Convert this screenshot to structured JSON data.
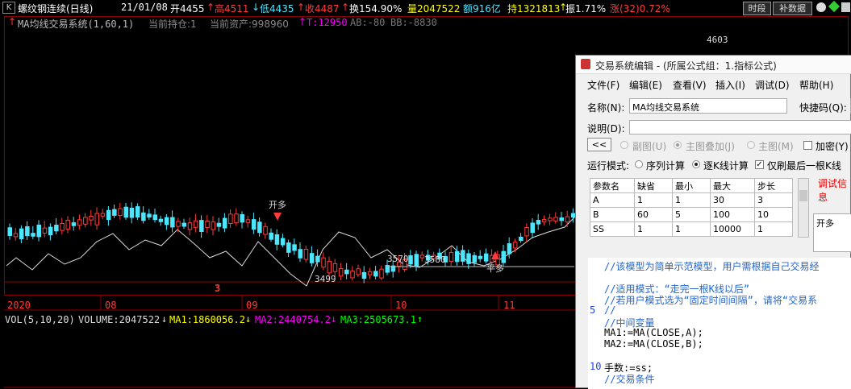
{
  "header": {
    "k_label": "K",
    "title": "螺纹钢连续(日线)",
    "date": "21/01/08",
    "open": "开4455",
    "high": "高4511",
    "low": "低4435",
    "close": "收4487",
    "turnover": "换154.90%",
    "volume": "量2047522",
    "amount": "额916亿",
    "hold": "持1321813",
    "amplitude": "振1.71%",
    "change": "涨(32)0.72%",
    "btn_period": "时段",
    "btn_supplement": "补数据"
  },
  "indicator_line": {
    "name": "MA均线交易系统(1,60,1)",
    "position": "当前持仓:1",
    "assets": "当前资产:998960",
    "t": "T:12950",
    "ab": "AB:-80",
    "bb": "BB:-8830"
  },
  "chart_data": {
    "type": "candlestick",
    "x_labels": [
      "2020",
      "08",
      "09",
      "10",
      "11"
    ],
    "annotations": [
      "4603",
      "3570",
      "3580",
      "3499",
      "开多",
      "平多",
      "开多",
      "平多"
    ],
    "signal_marker": "3",
    "candles_note": "daily OHLC candles for rebar continuous contract with an equity curve overlay"
  },
  "volume_line": {
    "label": "VOL(5,10,20)",
    "volume": "VOLUME:2047522",
    "ma1": "MA1:1860056.2",
    "ma2": "MA2:2440754.2",
    "ma3": "MA3:2505673.1"
  },
  "dialog": {
    "title": "交易系统编辑 - (所属公式组：1.指标公式)",
    "menu": [
      "文件(F)",
      "编辑(E)",
      "查看(V)",
      "插入(I)",
      "调试(D)",
      "帮助(H)"
    ],
    "name_label": "名称(N):",
    "name_value": "MA均线交易系统",
    "shortcut_label": "快捷码(Q):",
    "desc_label": "说明(D):",
    "nav_button": "<<",
    "radio_subchart": "副图(U)",
    "radio_overlay": "主图叠加(J)",
    "radio_main": "主图(M)",
    "encrypt": "加密(Y)",
    "mode_label": "运行模式:",
    "mode_sequence": "序列计算",
    "mode_bar": "逐K线计算",
    "refresh_last": "仅刷最后一根K线",
    "debug_info": "调试信息",
    "output_text": "开多",
    "param_headers": [
      "参数名",
      "缺省",
      "最小",
      "最大",
      "步长"
    ],
    "params": [
      [
        "A",
        "1",
        "1",
        "30",
        "3"
      ],
      [
        "B",
        "60",
        "5",
        "100",
        "10"
      ],
      [
        "SS",
        "1",
        "1",
        "10000",
        "1"
      ]
    ],
    "code_lines": [
      {
        "num": "",
        "text": "//该模型为简单示范模型，用户需根据自己交易经"
      },
      {
        "num": "",
        "text": ""
      },
      {
        "num": "",
        "text": "//适用模式：“走完一根K线以后”"
      },
      {
        "num": "",
        "text": "//若用户模式选为“固定时间间隔”，请将“交易系"
      },
      {
        "num": "5",
        "text": "//"
      },
      {
        "num": "",
        "text": "//中间变量"
      },
      {
        "num": "",
        "text": "MA1:=MA(CLOSE,A);"
      },
      {
        "num": "",
        "text": "MA2:=MA(CLOSE,B);"
      },
      {
        "num": "",
        "text": ""
      },
      {
        "num": "10",
        "text": "手数:=ss;"
      },
      {
        "num": "",
        "text": "//交易条件"
      }
    ]
  },
  "colors": {
    "up": "#ff3a3a",
    "down": "#4ce6ff",
    "gridline": "#8b0000",
    "yellow": "#ffff00",
    "magenta": "#ff00ff",
    "green": "#00ff00"
  }
}
